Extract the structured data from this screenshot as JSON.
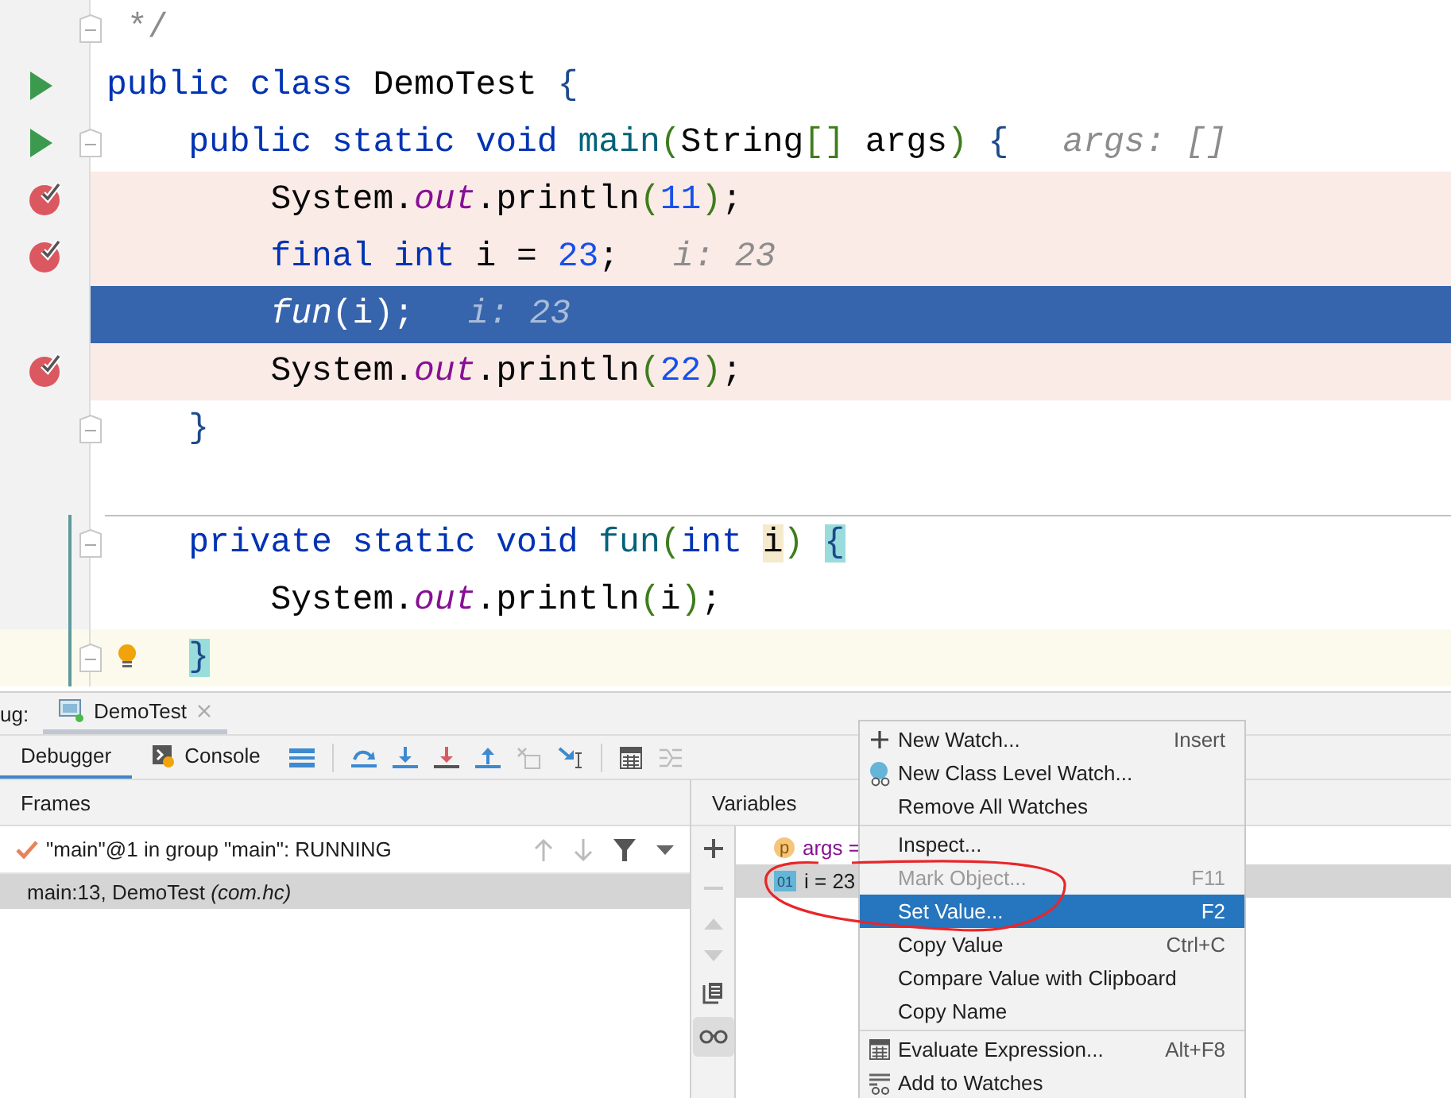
{
  "editor": {
    "lines": [
      {
        "tokens": [
          {
            "t": "*/",
            "kind": "comment"
          }
        ],
        "fold": true
      },
      {
        "tokens": [
          {
            "t": "public class ",
            "kind": "kw"
          },
          {
            "t": "DemoTest ",
            "kind": "plain"
          },
          {
            "t": "{",
            "kind": "brace"
          }
        ],
        "kind": "run",
        "children": [
          {
            "tokens": [
              {
                "t": "public static void ",
                "kind": "kw"
              },
              {
                "t": "main",
                "kind": "decl"
              },
              {
                "t": "(",
                "kind": "paren"
              },
              {
                "t": "String",
                "kind": "plain"
              },
              {
                "t": "[]",
                "kind": "paren"
              },
              {
                "t": " args",
                "kind": "plain"
              },
              {
                "t": ")",
                "kind": "paren"
              },
              {
                "t": " {",
                "kind": "brace"
              }
            ],
            "hint": "args: []",
            "kind": "run",
            "fold": true,
            "children": [
              {
                "tokens": [
                  {
                    "t": "System.",
                    "kind": "plain"
                  },
                  {
                    "t": "out",
                    "kind": "field"
                  },
                  {
                    "t": ".println",
                    "kind": "plain"
                  },
                  {
                    "t": "(",
                    "kind": "paren"
                  },
                  {
                    "t": "11",
                    "kind": "num"
                  },
                  {
                    "t": ")",
                    "kind": "paren"
                  },
                  {
                    "t": ";",
                    "kind": "plain"
                  }
                ],
                "breakpoint": true
              },
              {
                "tokens": [
                  {
                    "t": "final int ",
                    "kind": "kw"
                  },
                  {
                    "t": "i = ",
                    "kind": "plain"
                  },
                  {
                    "t": "23",
                    "kind": "num"
                  },
                  {
                    "t": ";",
                    "kind": "plain"
                  }
                ],
                "hint": "i: 23",
                "breakpoint": true
              },
              {
                "tokens": [
                  {
                    "t": "fun",
                    "kind": "static"
                  },
                  {
                    "t": "(i);",
                    "kind": "plain"
                  }
                ],
                "hint": "i: 23",
                "current": true
              },
              {
                "tokens": [
                  {
                    "t": "System.",
                    "kind": "plain"
                  },
                  {
                    "t": "out",
                    "kind": "field"
                  },
                  {
                    "t": ".println",
                    "kind": "plain"
                  },
                  {
                    "t": "(",
                    "kind": "paren"
                  },
                  {
                    "t": "22",
                    "kind": "num"
                  },
                  {
                    "t": ")",
                    "kind": "paren"
                  },
                  {
                    "t": ";",
                    "kind": "plain"
                  }
                ],
                "breakpoint": true
              }
            ]
          },
          {
            "tokens": [
              {
                "t": "}",
                "kind": "brace"
              }
            ],
            "fold": true
          },
          {
            "kind": "blank"
          },
          {
            "tokens": [
              {
                "t": "private static void ",
                "kind": "kw"
              },
              {
                "t": "fun",
                "kind": "decl"
              },
              {
                "t": "(",
                "kind": "paren"
              },
              {
                "t": "int ",
                "kind": "kw"
              },
              {
                "t": "i",
                "kind": "match-var"
              },
              {
                "t": ") ",
                "kind": "paren"
              },
              {
                "t": "{",
                "kind": "match-brace"
              }
            ],
            "fold": true,
            "separator_above": true,
            "changed": true,
            "children": [
              {
                "tokens": [
                  {
                    "t": "System.",
                    "kind": "plain"
                  },
                  {
                    "t": "out",
                    "kind": "field"
                  },
                  {
                    "t": ".println",
                    "kind": "plain"
                  },
                  {
                    "t": "(",
                    "kind": "paren"
                  },
                  {
                    "t": "i",
                    "kind": "plain"
                  },
                  {
                    "t": ")",
                    "kind": "paren"
                  },
                  {
                    "t": ";",
                    "kind": "plain"
                  }
                ],
                "changed": true
              }
            ]
          },
          {
            "tokens": [
              {
                "t": "}",
                "kind": "match-brace"
              }
            ],
            "caret": true,
            "fold": true,
            "bulb": true,
            "changed": true
          }
        ]
      }
    ]
  },
  "debug": {
    "label": "ug:",
    "session_tab": "DemoTest",
    "tabs": [
      {
        "label": "Debugger",
        "selected": true
      },
      {
        "label": "Console",
        "selected": false
      }
    ],
    "frames_header": "Frames",
    "thread": "\"main\"@1 in group \"main\": RUNNING",
    "frames": [
      {
        "method": "main:13, DemoTest",
        "package": "(com.hc)",
        "selected": true
      }
    ],
    "variables_header": "Variables",
    "variables": [
      {
        "kind": "param",
        "badge": "p",
        "text": "args =",
        "selected": false
      },
      {
        "kind": "primitive",
        "badge": "01",
        "text": "i = 23",
        "selected": true
      }
    ]
  },
  "menu": {
    "groups": [
      {
        "items": [
          {
            "label": "New Watch...",
            "shortcut": "Insert",
            "kind": "plus",
            "disabled": false,
            "selected": false
          },
          {
            "label": "New Class Level Watch...",
            "kind": "class",
            "disabled": false,
            "selected": false
          },
          {
            "label": "Remove All Watches",
            "disabled": false,
            "selected": false
          }
        ]
      },
      {
        "items": [
          {
            "label": "Inspect...",
            "disabled": false,
            "selected": false
          },
          {
            "label": "Mark Object...",
            "shortcut": "F11",
            "disabled": true,
            "selected": false
          },
          {
            "label": "Set Value...",
            "shortcut": "F2",
            "disabled": false,
            "selected": true
          },
          {
            "label": "Copy Value",
            "shortcut": "Ctrl+C",
            "disabled": false,
            "selected": false
          },
          {
            "label": "Compare Value with Clipboard",
            "disabled": false,
            "selected": false
          },
          {
            "label": "Copy Name",
            "disabled": false,
            "selected": false
          }
        ]
      },
      {
        "items": [
          {
            "label": "Evaluate Expression...",
            "shortcut": "Alt+F8",
            "kind": "calculator",
            "disabled": false,
            "selected": false
          },
          {
            "label": "Add to Watches",
            "kind": "watch",
            "disabled": false,
            "selected": false
          }
        ]
      }
    ]
  }
}
